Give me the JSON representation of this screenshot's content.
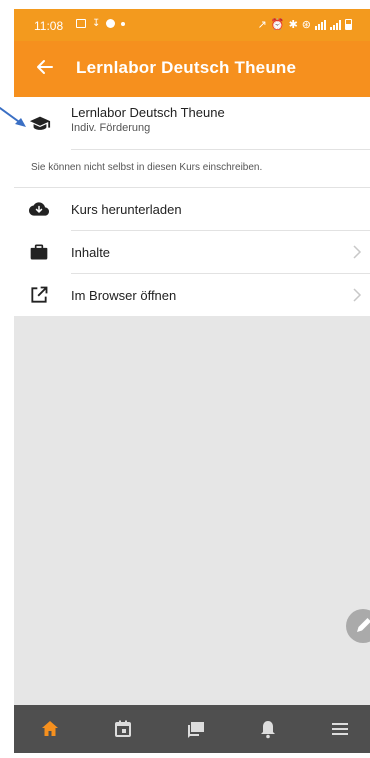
{
  "status_bar": {
    "time": "11:08"
  },
  "app_bar": {
    "title": "Lernlabor Deutsch Theune"
  },
  "course": {
    "title": "Lernlabor Deutsch Theune",
    "subtitle": "Indiv. Förderung"
  },
  "notice": "Sie können nicht selbst in diesen Kurs einschreiben.",
  "actions": [
    {
      "label": "Kurs herunterladen",
      "icon": "cloud-download-icon"
    },
    {
      "label": "Inhalte",
      "icon": "briefcase-icon"
    },
    {
      "label": "Im Browser öffnen",
      "icon": "open-external-icon"
    }
  ],
  "bottom_nav": [
    {
      "icon": "home-icon",
      "active": true
    },
    {
      "icon": "calendar-icon",
      "active": false
    },
    {
      "icon": "messages-icon",
      "active": false
    },
    {
      "icon": "bell-icon",
      "active": false
    },
    {
      "icon": "menu-icon",
      "active": false
    }
  ],
  "colors": {
    "accent": "#f6901e",
    "status_bar": "#f39a1e",
    "bottom_bar": "#4f4f4f",
    "background": "#e6e6e6",
    "annotation_arrow": "#3a6fc4"
  }
}
